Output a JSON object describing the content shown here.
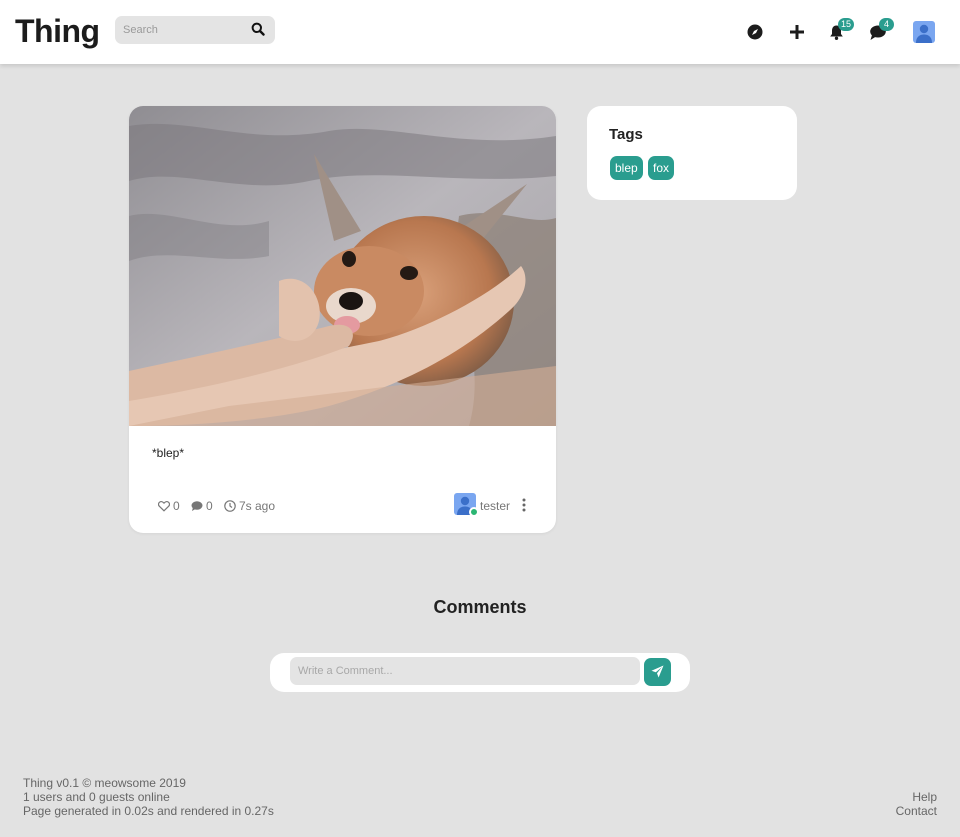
{
  "header": {
    "logo": "Thing",
    "search_placeholder": "Search",
    "icons": [
      "compass-icon",
      "plus-icon",
      "bell-icon",
      "chat-icon",
      "user-avatar"
    ],
    "notifications_count": "15",
    "messages_count": "4"
  },
  "post": {
    "image_subject": "fox being petted by two hands, tongue out",
    "caption": "*blep*",
    "likes": "0",
    "comments": "0",
    "time_ago": "7s ago",
    "author": "tester",
    "author_online": true
  },
  "tags": {
    "title": "Tags",
    "items": [
      "blep",
      "fox"
    ]
  },
  "comments": {
    "heading": "Comments",
    "placeholder": "Write a Comment..."
  },
  "footer": {
    "version": "Thing v0.1 © meowsome 2019",
    "online": "1 users and 0 guests online",
    "generated": "Page generated in 0.02s and rendered in 0.27s",
    "links": [
      "Help",
      "Contact"
    ]
  },
  "colors": {
    "accent": "#2a9d8f",
    "background": "#e2e2e2",
    "card": "#ffffff",
    "online": "#2bb673"
  }
}
